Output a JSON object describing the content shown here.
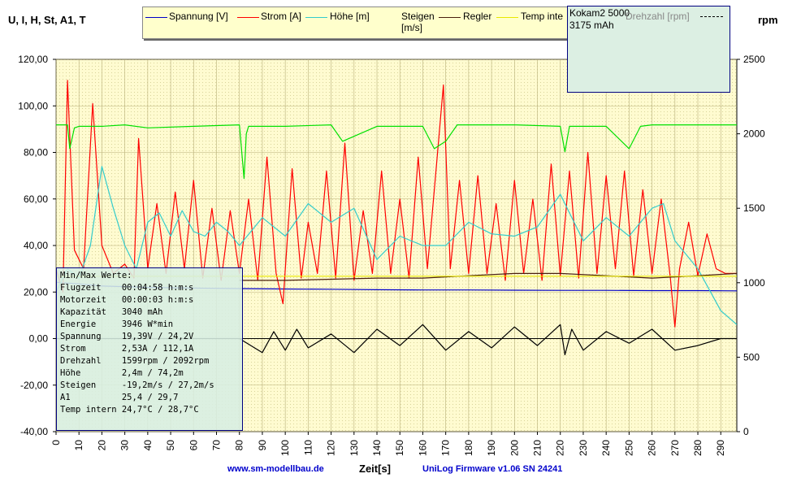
{
  "chart_data": {
    "type": "line",
    "left_axis_label": "U, I, H, St, A1, T",
    "right_axis_label": "rpm",
    "xlabel": "Zeit[s]",
    "xlim": [
      0,
      297
    ],
    "ylim_left": [
      -40,
      120
    ],
    "ylim_right": [
      0,
      2500
    ],
    "x_ticks": [
      "0",
      "10",
      "20",
      "30",
      "40",
      "50",
      "60",
      "70",
      "80",
      "90",
      "100",
      "110",
      "120",
      "130",
      "140",
      "150",
      "160",
      "170",
      "180",
      "190",
      "200",
      "210",
      "220",
      "230",
      "240",
      "250",
      "260",
      "270",
      "280",
      "290"
    ],
    "y_ticks_left": [
      "120,00",
      "100,00",
      "80,00",
      "60,00",
      "40,00",
      "20,00",
      "0,00",
      "-20,00",
      "-40,00"
    ],
    "y_ticks_right": [
      "2500",
      "2000",
      "1500",
      "1000",
      "500",
      "0"
    ],
    "series": [
      {
        "name": "Spannung [V]",
        "color": "#0000c8",
        "axis": "left",
        "x": [
          0,
          10,
          20,
          40,
          60,
          80,
          100,
          120,
          140,
          160,
          180,
          200,
          220,
          240,
          260,
          280,
          297
        ],
        "y": [
          24.2,
          23.5,
          22.6,
          22.0,
          21.7,
          21.5,
          21.3,
          21.2,
          21.0,
          20.9,
          20.9,
          20.8,
          20.7,
          20.7,
          20.6,
          20.6,
          20.5
        ]
      },
      {
        "name": "Strom [A]",
        "color": "#ff0000",
        "axis": "left",
        "x": [
          0,
          3,
          5,
          8,
          12,
          16,
          20,
          25,
          30,
          34,
          36,
          40,
          44,
          48,
          52,
          56,
          60,
          64,
          68,
          72,
          76,
          80,
          84,
          88,
          92,
          96,
          99,
          103,
          107,
          110,
          114,
          118,
          122,
          126,
          130,
          134,
          138,
          142,
          146,
          150,
          154,
          158,
          162,
          166,
          169,
          172,
          176,
          180,
          184,
          188,
          192,
          196,
          200,
          204,
          208,
          212,
          216,
          220,
          224,
          228,
          232,
          236,
          240,
          244,
          248,
          252,
          256,
          260,
          264,
          268,
          270,
          272,
          276,
          280,
          284,
          288,
          292,
          297
        ],
        "y": [
          30,
          20,
          111,
          38,
          30,
          101,
          40,
          28,
          32,
          26,
          86,
          30,
          58,
          28,
          63,
          30,
          68,
          26,
          56,
          25,
          55,
          28,
          60,
          25,
          78,
          28,
          15,
          73,
          26,
          50,
          28,
          72,
          26,
          84,
          25,
          55,
          28,
          72,
          28,
          60,
          26,
          78,
          30,
          75,
          109,
          30,
          68,
          28,
          70,
          28,
          58,
          25,
          68,
          28,
          60,
          25,
          75,
          27,
          72,
          26,
          80,
          28,
          70,
          30,
          72,
          27,
          64,
          28,
          60,
          26,
          5,
          30,
          50,
          27,
          45,
          30,
          28,
          28
        ]
      },
      {
        "name": "Höhe [m]",
        "color": "#33cccc",
        "axis": "left",
        "x": [
          0,
          5,
          10,
          15,
          20,
          25,
          30,
          35,
          40,
          45,
          50,
          55,
          60,
          65,
          70,
          75,
          80,
          90,
          100,
          110,
          120,
          130,
          140,
          150,
          160,
          170,
          180,
          190,
          200,
          210,
          220,
          230,
          240,
          250,
          260,
          265,
          270,
          280,
          290,
          297
        ],
        "y": [
          20,
          30,
          26,
          40,
          74,
          56,
          40,
          30,
          50,
          54,
          44,
          55,
          46,
          44,
          50,
          46,
          40,
          52,
          44,
          58,
          50,
          56,
          34,
          44,
          40,
          40,
          50,
          45,
          44,
          48,
          62,
          42,
          52,
          44,
          56,
          58,
          42,
          30,
          12,
          6
        ]
      },
      {
        "name": "Steigen [m/s]",
        "color": "#000000",
        "axis": "left",
        "x": [
          0,
          20,
          40,
          60,
          80,
          90,
          95,
          100,
          105,
          110,
          120,
          130,
          140,
          150,
          160,
          170,
          180,
          190,
          200,
          210,
          220,
          222,
          225,
          230,
          240,
          250,
          260,
          270,
          280,
          290,
          297
        ],
        "y": [
          0,
          0,
          0,
          0,
          0,
          -6,
          3,
          -5,
          4,
          -4,
          2,
          -6,
          4,
          -3,
          6,
          -5,
          3,
          -4,
          5,
          -3,
          6,
          -7,
          4,
          -5,
          3,
          -2,
          4,
          -5,
          -3,
          0,
          0
        ]
      },
      {
        "name": "Regler",
        "color": "#4a1f0f",
        "axis": "left",
        "x": [
          80,
          100,
          120,
          140,
          160,
          180,
          200,
          220,
          240,
          260,
          280,
          297
        ],
        "y": [
          25,
          25,
          25.5,
          26,
          26,
          27,
          28,
          28,
          27,
          26,
          27,
          28
        ]
      },
      {
        "name": "Temp intern [°C]",
        "color": "#e8e800",
        "axis": "left",
        "x": [
          0,
          297
        ],
        "y": [
          26.8,
          26.8
        ]
      },
      {
        "name": "Drehzahl [rpm]",
        "color": "#00e000",
        "axis": "right",
        "x": [
          0,
          5,
          6,
          8,
          10,
          15,
          20,
          30,
          40,
          60,
          80,
          82,
          83,
          84,
          100,
          120,
          125,
          140,
          160,
          165,
          170,
          175,
          200,
          220,
          222,
          224,
          240,
          250,
          255,
          260,
          270,
          280,
          297
        ],
        "y": [
          2060,
          2060,
          1900,
          2040,
          2050,
          2050,
          2050,
          2060,
          2040,
          2050,
          2060,
          1700,
          2000,
          2050,
          2050,
          2060,
          1950,
          2050,
          2050,
          1900,
          1950,
          2060,
          2060,
          2050,
          1880,
          2050,
          2050,
          1900,
          2050,
          2060,
          2060,
          2060,
          2060
        ]
      }
    ]
  },
  "legend": [
    {
      "label": "Spannung [V]",
      "color": "#0000c8"
    },
    {
      "label": "Strom [A]",
      "color": "#ff0000"
    },
    {
      "label": "Höhe [m]",
      "color": "#33cccc"
    },
    {
      "label": "Steigen",
      "label2": "[m/s]",
      "color": "#000000"
    },
    {
      "label": "Regler",
      "color": "#4a1f0f"
    },
    {
      "label": "Temp inte",
      "color": "#e8e800"
    }
  ],
  "battery": {
    "line1": "Kokam2 5000",
    "line2": "3175 mAh",
    "overlay": "Drehzahl [rpm]"
  },
  "stats": {
    "title": "Min/Max Werte:",
    "rows": [
      "Flugzeit    00:04:58 h:m:s",
      "Motorzeit   00:00:03 h:m:s",
      "Kapazität   3040 mAh",
      "Energie     3946 W*min",
      "Spannung    19,39V / 24,2V",
      "Strom       2,53A / 112,1A",
      "Drehzahl    1599rpm / 2092rpm",
      "Höhe        2,4m / 74,2m",
      "Steigen     -19,2m/s / 27,2m/s",
      "A1          25,4 / 29,7",
      "Temp intern 24,7°C / 28,7°C"
    ]
  },
  "footer": {
    "website": "www.sm-modellbau.de",
    "firmware": "UniLog Firmware v1.06 SN 24241"
  }
}
